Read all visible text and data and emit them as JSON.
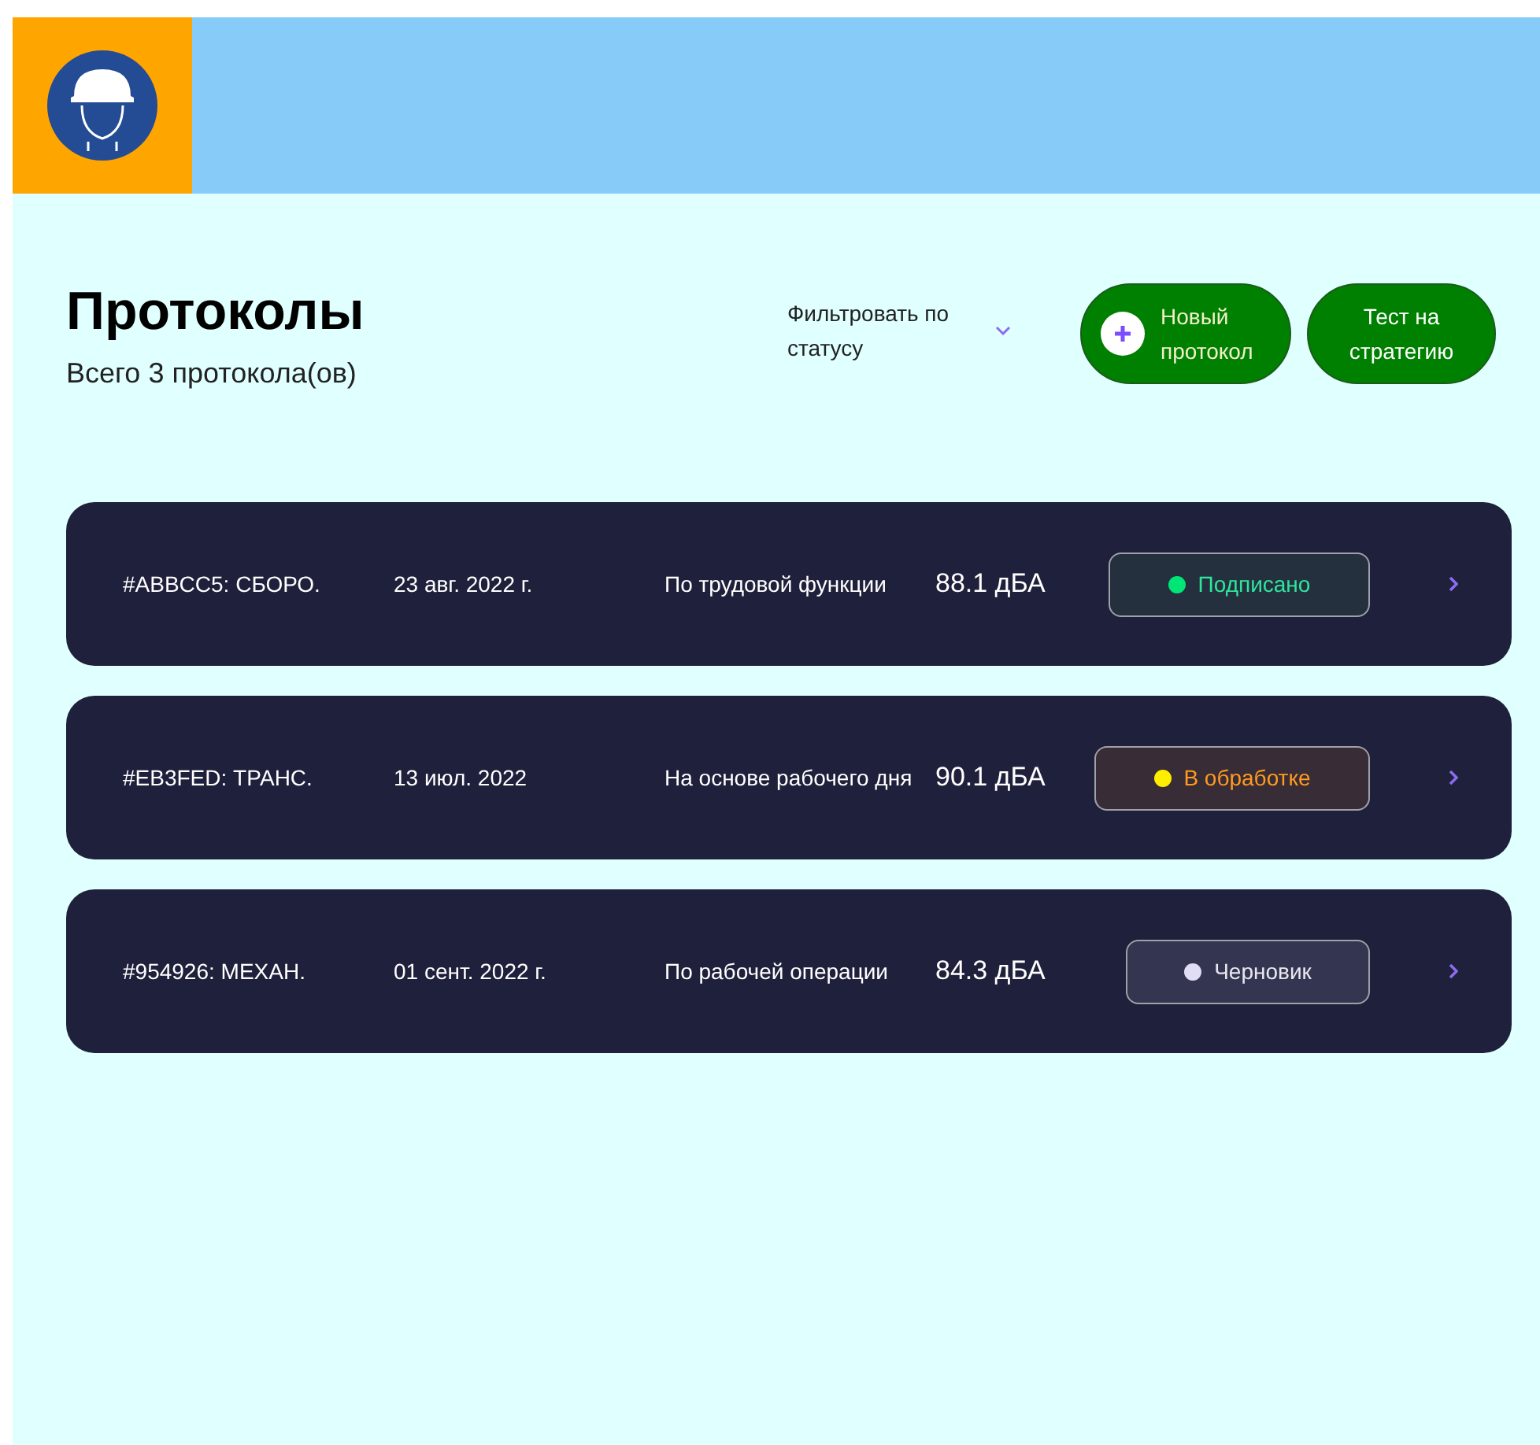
{
  "header": {
    "logo": {
      "kind": "helmet"
    }
  },
  "title": "Протоколы",
  "subtitle": "Всего 3 протокола(ов)",
  "filter": {
    "label": "Фильтровать по статусу"
  },
  "buttons": [
    {
      "label": "Новый протокол",
      "kind": "add"
    },
    {
      "label": "Тест на стратегию",
      "kind": "plain"
    }
  ],
  "protocols": [
    {
      "id": "#ABBCC5: СБОРО.",
      "date": "23 авг. 2022 г.",
      "method": "По трудовой функции",
      "level": "88.1 дБА",
      "status": {
        "label": "Подписано",
        "kind": "signed",
        "color": "#00e676"
      }
    },
    {
      "id": "#EB3FED: ТРАНС.",
      "date": "13 июл. 2022",
      "method": "На основе рабочего дня",
      "level": "90.1 дБА",
      "status": {
        "label": "В обработке",
        "kind": "processing",
        "color": "#ffee00"
      }
    },
    {
      "id": "#954926: МЕХАН.",
      "date": "01 сент. 2022 г.",
      "method": "По рабочей операции",
      "level": "84.3 дБА",
      "status": {
        "label": "Черновик",
        "kind": "draft",
        "color": "#e0ddf5"
      }
    }
  ]
}
